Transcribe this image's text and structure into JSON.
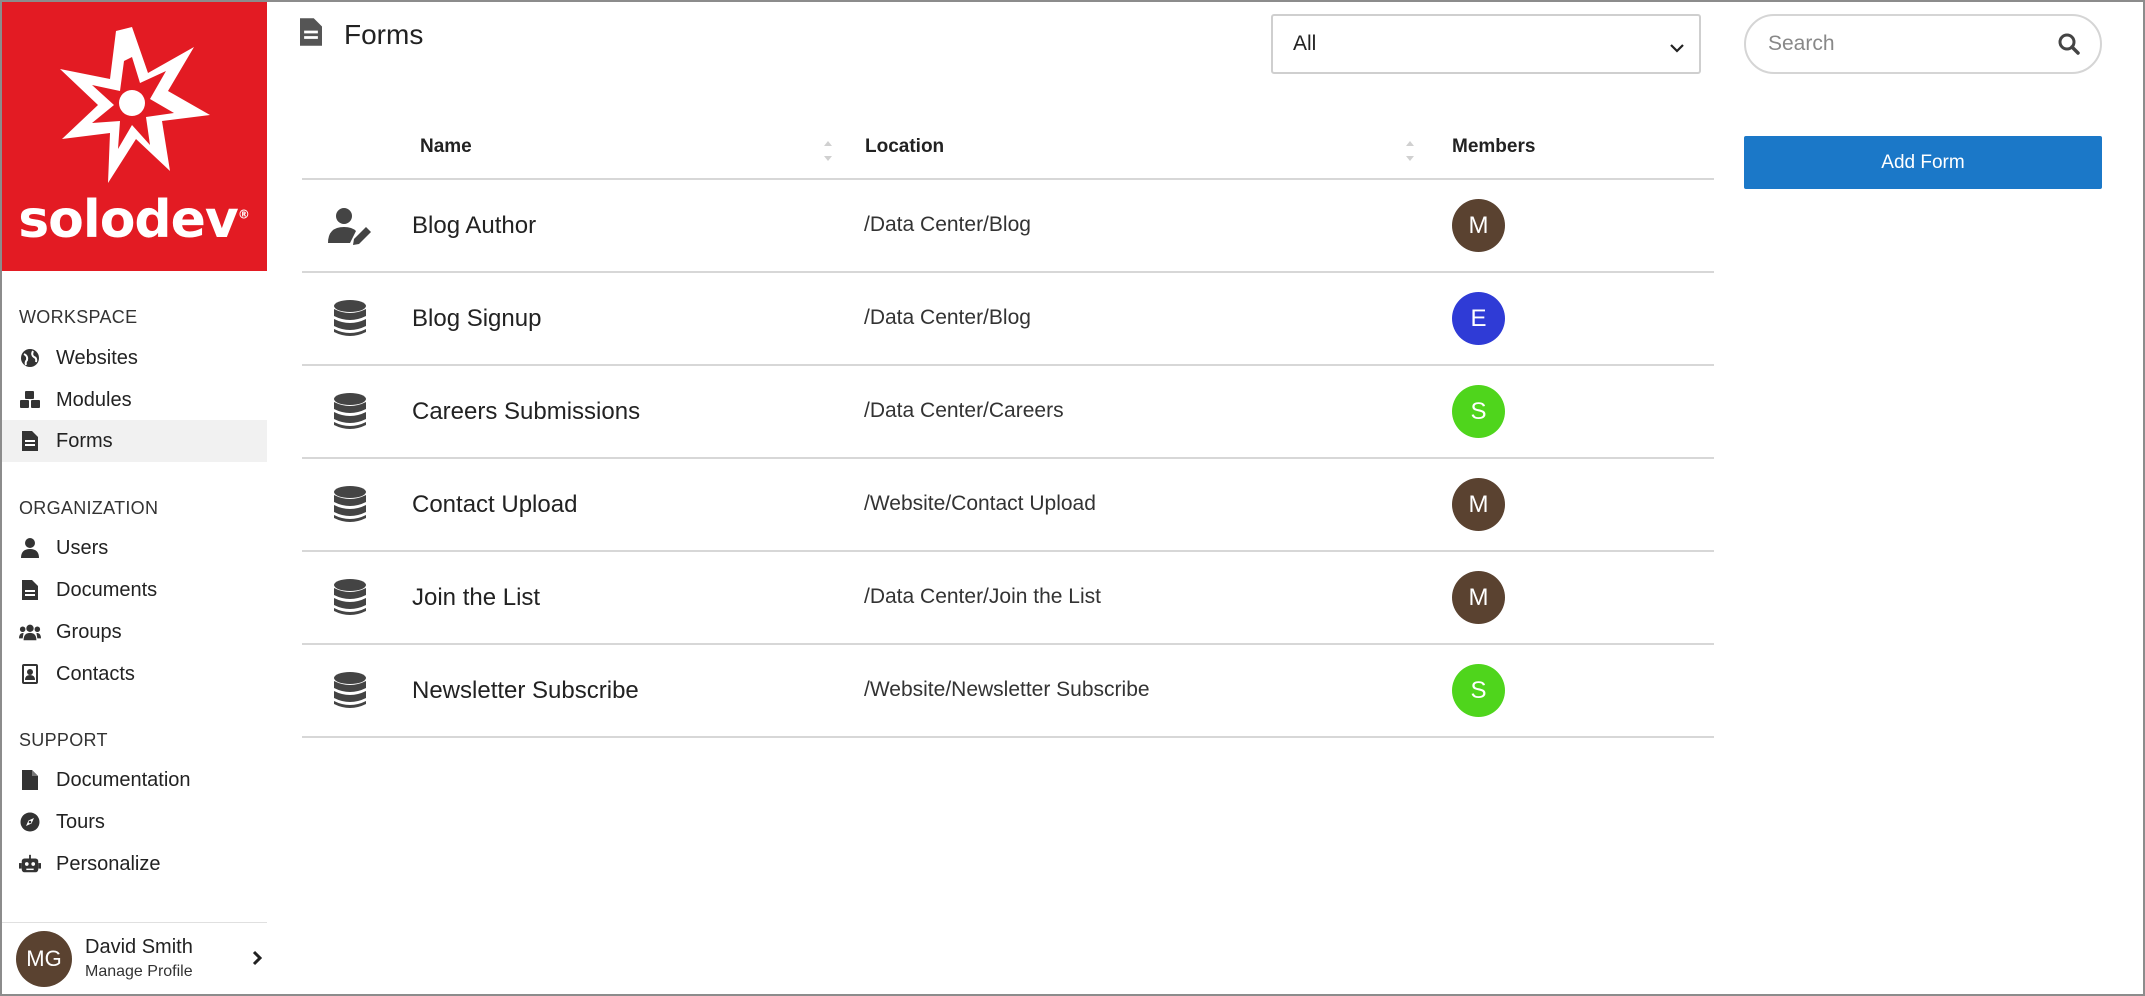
{
  "brand": {
    "name": "solodev",
    "reg": "®",
    "color": "#e31b23"
  },
  "sidebar": {
    "sections": [
      {
        "label": "WORKSPACE",
        "items": [
          {
            "label": "Websites",
            "icon": "globe-icon"
          },
          {
            "label": "Modules",
            "icon": "cubes-icon"
          },
          {
            "label": "Forms",
            "icon": "file-form-icon",
            "active": true
          }
        ]
      },
      {
        "label": "ORGANIZATION",
        "items": [
          {
            "label": "Users",
            "icon": "user-icon"
          },
          {
            "label": "Documents",
            "icon": "document-icon"
          },
          {
            "label": "Groups",
            "icon": "users-group-icon"
          },
          {
            "label": "Contacts",
            "icon": "address-book-icon"
          }
        ]
      },
      {
        "label": "SUPPORT",
        "items": [
          {
            "label": "Documentation",
            "icon": "file-icon"
          },
          {
            "label": "Tours",
            "icon": "compass-icon"
          },
          {
            "label": "Personalize",
            "icon": "robot-icon"
          }
        ]
      }
    ],
    "profile": {
      "initials": "MG",
      "name": "David Smith",
      "link": "Manage Profile",
      "avatar_color": "#5a4230"
    }
  },
  "header": {
    "title": "Forms",
    "filter_value": "All",
    "search_placeholder": "Search",
    "add_button": "Add Form",
    "accent": "#1b78c8"
  },
  "table": {
    "columns": [
      "Name",
      "Location",
      "Members"
    ],
    "rows": [
      {
        "icon": "user-edit-icon",
        "name": "Blog Author",
        "location": "/Data Center/Blog",
        "member": "M",
        "member_color": "#5a4230"
      },
      {
        "icon": "database-icon",
        "name": "Blog Signup",
        "location": "/Data Center/Blog",
        "member": "E",
        "member_color": "#2f3bd6"
      },
      {
        "icon": "database-icon",
        "name": "Careers Submissions",
        "location": "/Data Center/Careers",
        "member": "S",
        "member_color": "#4fd51c"
      },
      {
        "icon": "database-icon",
        "name": "Contact Upload",
        "location": "/Website/Contact Upload",
        "member": "M",
        "member_color": "#5a4230"
      },
      {
        "icon": "database-icon",
        "name": "Join the List",
        "location": "/Data Center/Join the List",
        "member": "M",
        "member_color": "#5a4230"
      },
      {
        "icon": "database-icon",
        "name": "Newsletter Subscribe",
        "location": "/Website/Newsletter Subscribe",
        "member": "S",
        "member_color": "#4fd51c"
      }
    ]
  }
}
